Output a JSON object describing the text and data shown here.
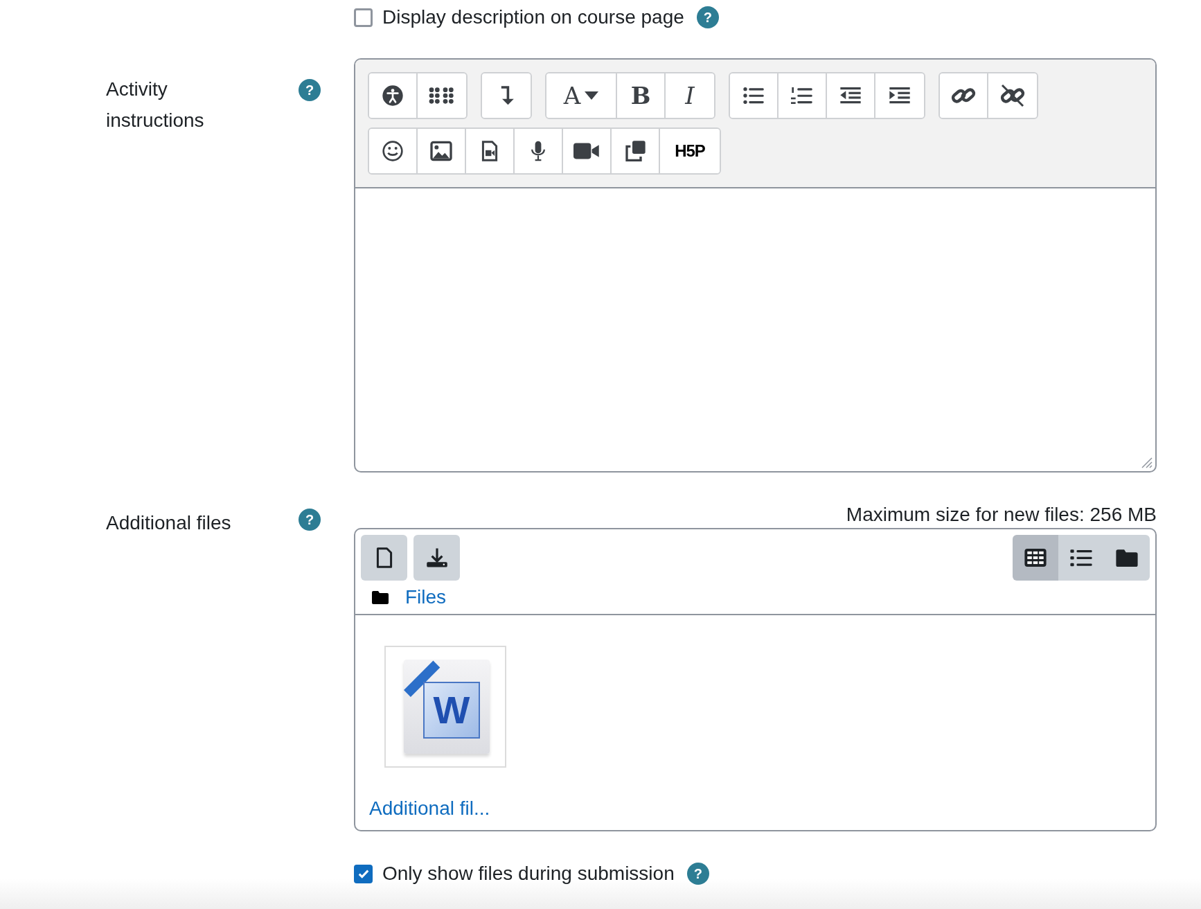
{
  "display_description": {
    "label": "Display description on course page",
    "checked": false,
    "help": "?"
  },
  "activity_instructions": {
    "label": "Activity instructions",
    "help": "?",
    "toolbar_rows": [
      [
        [
          {
            "kind": "accessibility"
          },
          {
            "kind": "grid"
          }
        ],
        [
          {
            "kind": "arrow-down"
          }
        ],
        [
          {
            "kind": "font",
            "text": "A"
          },
          {
            "kind": "bold",
            "text": "B"
          },
          {
            "kind": "italic",
            "text": "I"
          }
        ],
        [
          {
            "kind": "bullets"
          },
          {
            "kind": "numbers"
          },
          {
            "kind": "outdent"
          },
          {
            "kind": "indent"
          }
        ],
        [
          {
            "kind": "link"
          },
          {
            "kind": "unlink"
          }
        ]
      ],
      [
        [
          {
            "kind": "smiley"
          },
          {
            "kind": "image"
          },
          {
            "kind": "media-file"
          },
          {
            "kind": "microphone"
          },
          {
            "kind": "video"
          },
          {
            "kind": "copy"
          },
          {
            "kind": "h5p",
            "text": "H5P"
          }
        ]
      ]
    ]
  },
  "additional_files": {
    "label": "Additional files",
    "help": "?",
    "max_size": "Maximum size for new files: 256 MB",
    "actions": [
      {
        "kind": "add-file"
      },
      {
        "kind": "download"
      }
    ],
    "views": [
      {
        "kind": "grid",
        "selected": true
      },
      {
        "kind": "list",
        "selected": false
      },
      {
        "kind": "folder",
        "selected": false
      }
    ],
    "path": "Files",
    "files": [
      {
        "name": "Additional fil...",
        "letter": "W"
      }
    ]
  },
  "only_show_files": {
    "label": "Only show files during submission",
    "checked": true,
    "help": "?"
  }
}
